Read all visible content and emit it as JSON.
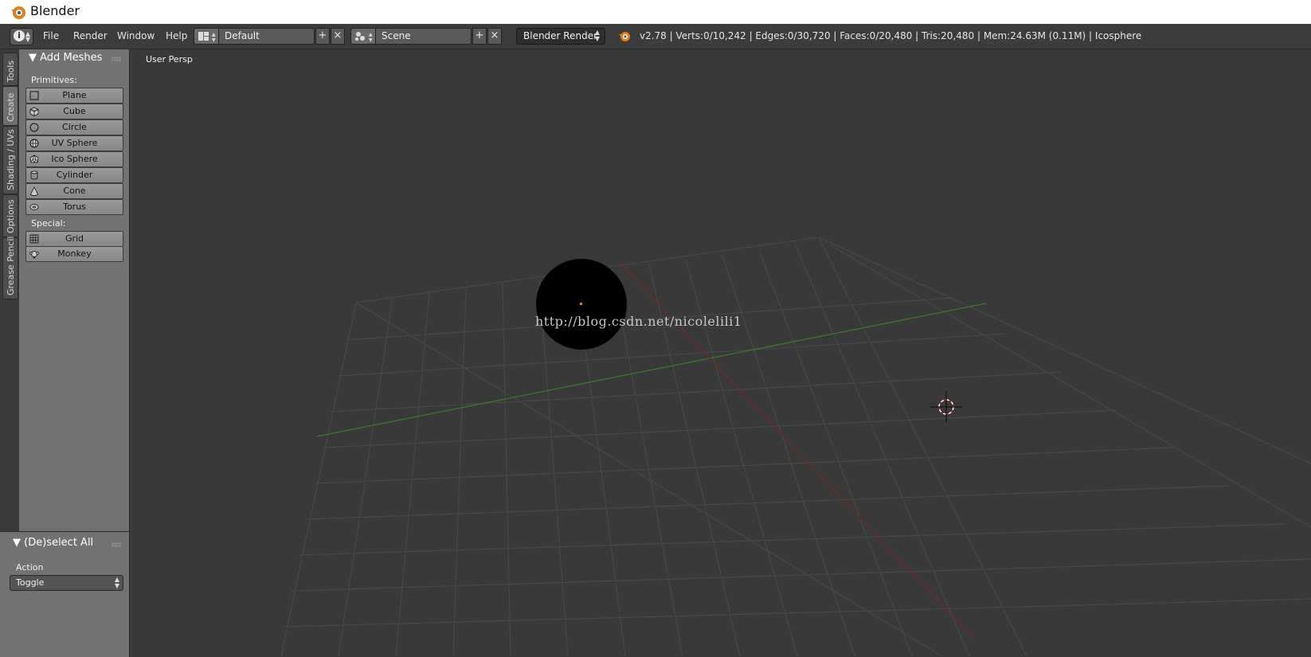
{
  "window": {
    "title": "Blender"
  },
  "header": {
    "menus": [
      "File",
      "Render",
      "Window",
      "Help"
    ],
    "layout_name": "Default",
    "scene_name": "Scene",
    "render_engine": "Blender Render",
    "status": "v2.78 | Verts:0/10,242 | Edges:0/30,720 | Faces:0/20,480 | Tris:20,480 | Mem:24.63M (0.11M) | Icosphere"
  },
  "tabs": [
    "Tools",
    "Create",
    "Shading / UVs",
    "Options",
    "Grease Pencil"
  ],
  "toolshelf": {
    "panel_title": "Add Meshes",
    "primitives_label": "Primitives:",
    "primitives": [
      "Plane",
      "Cube",
      "Circle",
      "UV Sphere",
      "Ico Sphere",
      "Cylinder",
      "Cone",
      "Torus"
    ],
    "special_label": "Special:",
    "special": [
      "Grid",
      "Monkey"
    ]
  },
  "operator_panel": {
    "title": "(De)select All",
    "action_label": "Action",
    "action_value": "Toggle"
  },
  "viewport": {
    "label": "User Persp",
    "watermark": "http://blog.csdn.net/nicolelili1"
  },
  "colors": {
    "accent": "#e87d0d",
    "x_axis": "#7a2a2a",
    "y_axis": "#3a7a2a"
  }
}
